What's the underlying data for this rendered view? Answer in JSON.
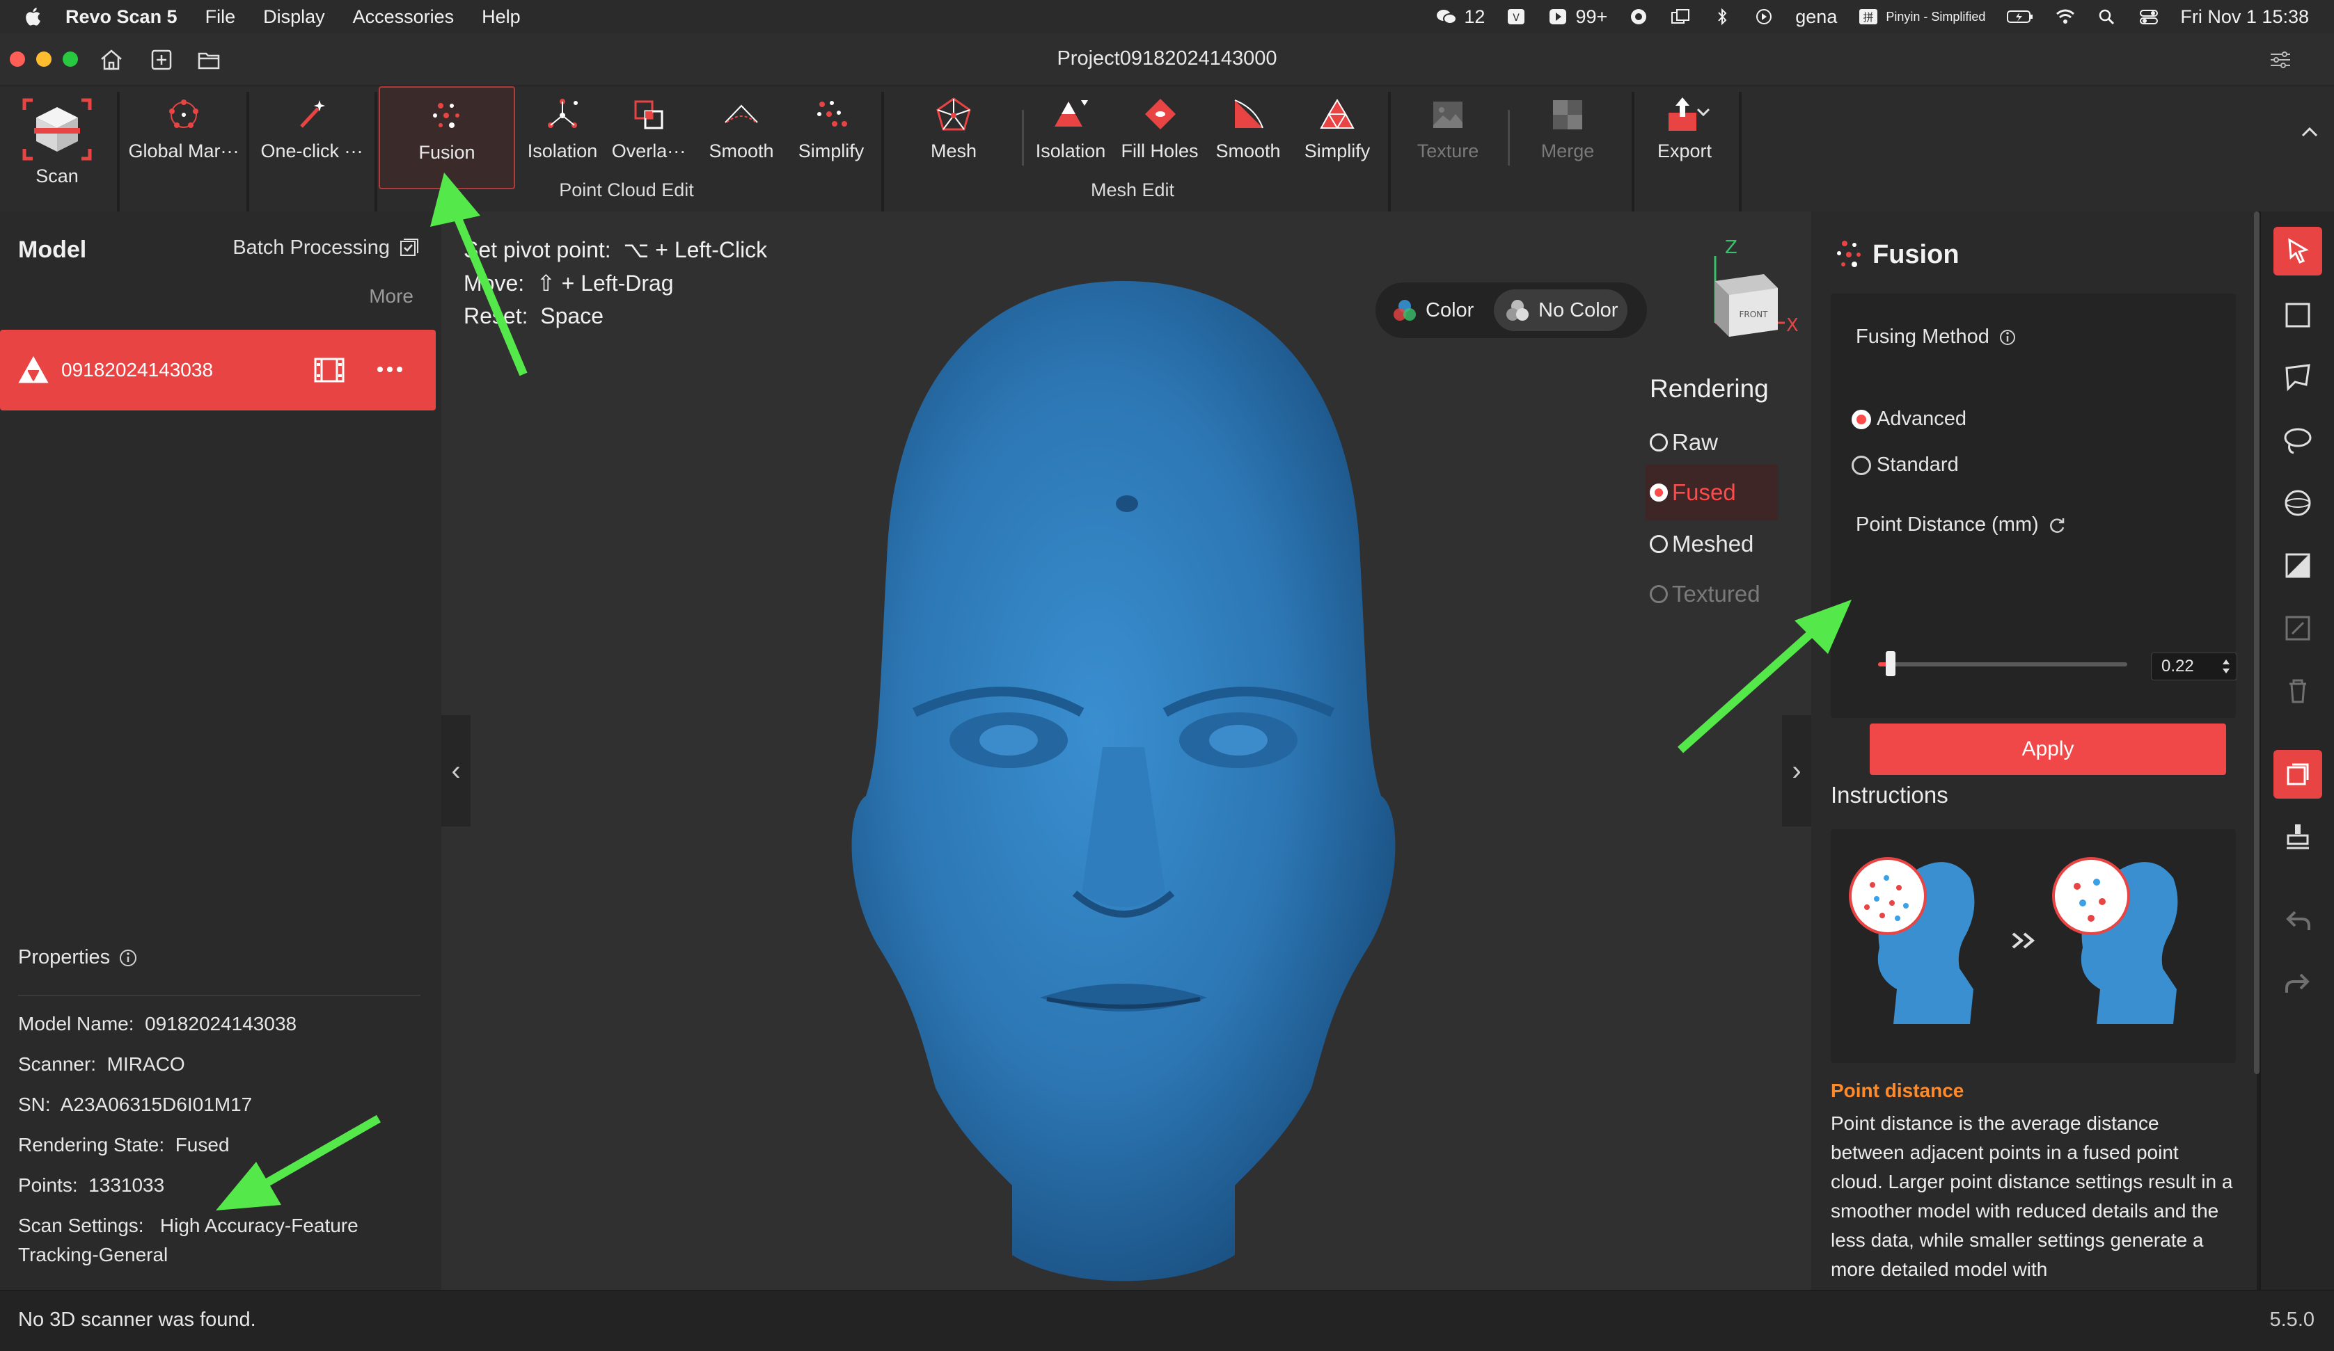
{
  "menubar": {
    "app_name": "Revo Scan 5",
    "menus": [
      "File",
      "Display",
      "Accessories",
      "Help"
    ],
    "status_items": {
      "wechat_count": "12",
      "notif_count": "99+",
      "user": "gena",
      "input_method": "Pinyin - Simplified",
      "datetime": "Fri Nov 1  15:38"
    }
  },
  "window": {
    "title": "Project09182024143000"
  },
  "toolbar": {
    "scan_label": "Scan",
    "point_cloud_group_label": "Point Cloud Edit",
    "mesh_group_label": "Mesh Edit",
    "point_cloud_tools": [
      "Global Mar···",
      "One-click ···",
      "Fusion",
      "Isolation",
      "Overla···",
      "Smooth",
      "Simplify"
    ],
    "mesh_tools": [
      "Mesh",
      "Isolation",
      "Fill Holes",
      "Smooth",
      "Simplify"
    ],
    "texture_label": "Texture",
    "merge_label": "Merge",
    "export_label": "Export",
    "accent_color": "#e84444"
  },
  "left_panel": {
    "model_title": "Model",
    "batch_processing_label": "Batch Processing",
    "more_label": "More",
    "model_item_name": "09182024143038",
    "properties_title": "Properties",
    "properties": [
      {
        "label": "Model Name:",
        "value": "09182024143038"
      },
      {
        "label": "Scanner:",
        "value": "MIRACO"
      },
      {
        "label": "SN:",
        "value": "A23A06315D6I01M17"
      },
      {
        "label": "Rendering State:",
        "value": "Fused"
      },
      {
        "label": "Points:",
        "value": "1331033"
      },
      {
        "label": "Scan Settings:",
        "value": "High Accuracy-Feature"
      },
      {
        "label": "",
        "value": "Tracking-General"
      }
    ]
  },
  "viewport": {
    "hints": [
      {
        "label": "Set pivot point:",
        "keys": "⌥ + Left-Click"
      },
      {
        "label": "Move:",
        "keys": "⇧ + Left-Drag"
      },
      {
        "label": "Reset:",
        "keys": "Space"
      }
    ],
    "color_label": "Color",
    "no_color_label": "No Color",
    "gizmo": {
      "z": "Z",
      "x": "X",
      "front": "FRONT"
    },
    "rendering_title": "Rendering",
    "rendering_options": [
      {
        "label": "Raw",
        "state": "normal"
      },
      {
        "label": "Fused",
        "state": "selected"
      },
      {
        "label": "Meshed",
        "state": "normal"
      },
      {
        "label": "Textured",
        "state": "disabled"
      }
    ],
    "model_color": "#2e7ab8"
  },
  "fusion_panel": {
    "title": "Fusion",
    "fusing_method_label": "Fusing Method",
    "methods": [
      {
        "label": "Advanced",
        "selected": true
      },
      {
        "label": "Standard",
        "selected": false
      }
    ],
    "point_distance_label": "Point Distance (mm)",
    "point_distance_value": "0.22",
    "slider_fraction": 0.05,
    "apply_label": "Apply",
    "instructions_title": "Instructions",
    "point_distance_heading": "Point distance",
    "point_distance_text": "Point distance is the average distance between adjacent points in a fused point cloud. Larger point distance settings result in a smoother model with reduced details and the less data, while smaller settings generate a more detailed model with"
  },
  "status_bar": {
    "message": "No 3D scanner was found.",
    "version": "5.5.0"
  }
}
